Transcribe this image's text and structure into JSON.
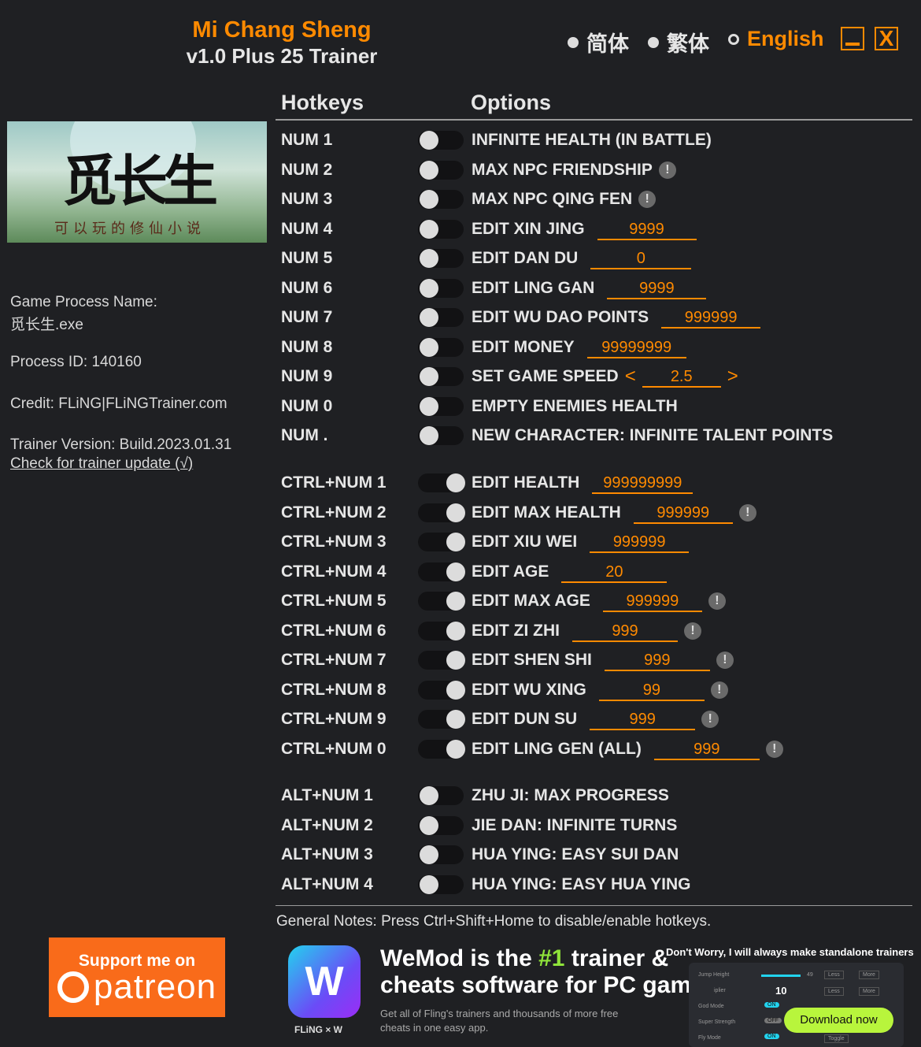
{
  "header": {
    "title": "Mi Chang Sheng",
    "subtitle": "v1.0 Plus 25 Trainer"
  },
  "languages": [
    {
      "label": "简体",
      "selected": false
    },
    {
      "label": "繁体",
      "selected": false
    },
    {
      "label": "English",
      "selected": true
    }
  ],
  "window": {
    "minimize_icon": "minimize-icon",
    "close_label": "X"
  },
  "cover": {
    "logo_text": "觅长生",
    "tagline": "可以玩的修仙小说"
  },
  "info": {
    "process_name_label": "Game Process Name:",
    "process_name": "觅长生.exe",
    "process_id": "Process ID: 140160",
    "credit": "Credit: FLiNG|FLiNGTrainer.com",
    "version": "Trainer Version: Build.2023.01.31",
    "update_link": "Check for trainer update (√)"
  },
  "columns": {
    "hotkeys": "Hotkeys",
    "options": "Options"
  },
  "accent": "#ff8a00",
  "rows": [
    {
      "hotkey": "NUM 1",
      "label": "INFINITE HEALTH (IN BATTLE)",
      "on": false
    },
    {
      "hotkey": "NUM 2",
      "label": "MAX NPC FRIENDSHIP",
      "on": false,
      "warn": true
    },
    {
      "hotkey": "NUM 3",
      "label": "MAX NPC QING FEN",
      "on": false,
      "warn": true
    },
    {
      "hotkey": "NUM 4",
      "label": "EDIT XIN JING",
      "on": false,
      "value": "9999"
    },
    {
      "hotkey": "NUM 5",
      "label": "EDIT DAN DU",
      "on": false,
      "value": "0"
    },
    {
      "hotkey": "NUM 6",
      "label": "EDIT LING GAN",
      "on": false,
      "value": "9999"
    },
    {
      "hotkey": "NUM 7",
      "label": "EDIT WU DAO POINTS",
      "on": false,
      "value": "999999"
    },
    {
      "hotkey": "NUM 8",
      "label": "EDIT MONEY",
      "on": false,
      "value": "99999999"
    },
    {
      "hotkey": "NUM 9",
      "label": "SET GAME SPEED",
      "on": false,
      "value": "2.5",
      "arrows": [
        "<",
        ">"
      ]
    },
    {
      "hotkey": "NUM 0",
      "label": "EMPTY ENEMIES HEALTH",
      "on": false
    },
    {
      "hotkey": "NUM .",
      "label": "NEW CHARACTER: INFINITE TALENT POINTS",
      "on": false
    },
    {
      "hotkey": "CTRL+NUM 1",
      "label": "EDIT HEALTH",
      "on": true,
      "value": "999999999"
    },
    {
      "hotkey": "CTRL+NUM 2",
      "label": "EDIT MAX HEALTH",
      "on": true,
      "value": "999999",
      "warn": true
    },
    {
      "hotkey": "CTRL+NUM 3",
      "label": "EDIT XIU WEI",
      "on": true,
      "value": "999999"
    },
    {
      "hotkey": "CTRL+NUM 4",
      "label": "EDIT AGE",
      "on": true,
      "value": "20"
    },
    {
      "hotkey": "CTRL+NUM 5",
      "label": "EDIT MAX AGE",
      "on": true,
      "value": "999999",
      "warn": true
    },
    {
      "hotkey": "CTRL+NUM 6",
      "label": "EDIT ZI ZHI",
      "on": true,
      "value": "999",
      "warn": true
    },
    {
      "hotkey": "CTRL+NUM 7",
      "label": "EDIT SHEN SHI",
      "on": true,
      "value": "999",
      "warn": true
    },
    {
      "hotkey": "CTRL+NUM 8",
      "label": "EDIT WU XING",
      "on": true,
      "value": "99",
      "warn": true
    },
    {
      "hotkey": "CTRL+NUM 9",
      "label": "EDIT DUN SU",
      "on": true,
      "value": "999",
      "warn": true
    },
    {
      "hotkey": "CTRL+NUM 0",
      "label": "EDIT LING GEN (ALL)",
      "on": true,
      "value": "999",
      "warn": true
    },
    {
      "hotkey": "ALT+NUM 1",
      "label": "ZHU JI: MAX PROGRESS",
      "on": false
    },
    {
      "hotkey": "ALT+NUM 2",
      "label": "JIE DAN: INFINITE TURNS",
      "on": false
    },
    {
      "hotkey": "ALT+NUM 3",
      "label": "HUA YING: EASY SUI DAN",
      "on": false
    },
    {
      "hotkey": "ALT+NUM 4",
      "label": "HUA YING: EASY HUA YING",
      "on": false
    }
  ],
  "warn_glyph": "!",
  "notes": "General Notes: Press Ctrl+Shift+Home to disable/enable hotkeys.",
  "patreon": {
    "support": "Support me on",
    "brand": "patreon"
  },
  "wemod": {
    "head1a": "WeMod is the ",
    "head1b": "#1",
    "head1c": " trainer &",
    "head2": "cheats software for PC games",
    "sub": "Get all of Fling's trainers and thousands of more free cheats in one easy app.",
    "fling": "FLiNG × W",
    "dont_worry": "Don't Worry, I will always make standalone trainers",
    "download": "Download now",
    "mock": {
      "jump": "Jump Height",
      "jump_val": "49",
      "mult": "iplier",
      "mult_val": "10",
      "god": "God Mode",
      "strength": "Super Strength",
      "fly": "Fly Mode",
      "on": "ON",
      "off": "OFF",
      "less": "Less",
      "more": "More",
      "toggle": "Toggle"
    }
  }
}
